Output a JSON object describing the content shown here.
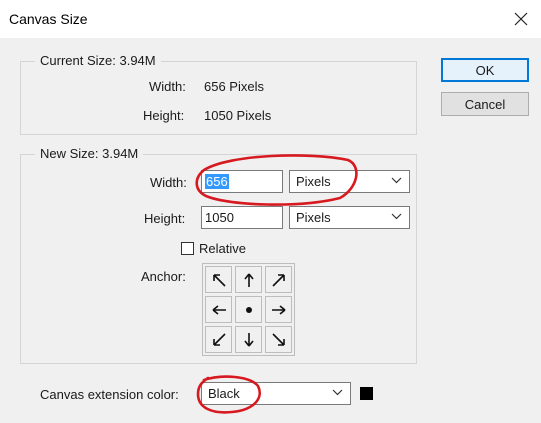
{
  "window": {
    "title": "Canvas Size"
  },
  "buttons": {
    "ok": "OK",
    "cancel": "Cancel"
  },
  "current_size": {
    "legend": "Current Size: 3.94M",
    "width_label": "Width:",
    "width_value": "656 Pixels",
    "height_label": "Height:",
    "height_value": "1050 Pixels"
  },
  "new_size": {
    "legend": "New Size: 3.94M",
    "width_label": "Width:",
    "width_value": "656",
    "width_unit": "Pixels",
    "height_label": "Height:",
    "height_value": "1050",
    "height_unit": "Pixels",
    "relative_label": "Relative",
    "relative_checked": false,
    "anchor_label": "Anchor:",
    "anchor_selected": "center"
  },
  "extension": {
    "label": "Canvas extension color:",
    "value": "Black",
    "swatch_color": "#000000"
  },
  "colors": {
    "annotation": "#d71920",
    "selection": "#3399ff",
    "primary_border": "#0078d7"
  },
  "icons": {
    "close": "close-icon",
    "chevron": "chevron-down-icon",
    "anchor": [
      "arrow-up-left-icon",
      "arrow-up-icon",
      "arrow-up-right-icon",
      "arrow-left-icon",
      "anchor-center-dot-icon",
      "arrow-right-icon",
      "arrow-down-left-icon",
      "arrow-down-icon",
      "arrow-down-right-icon"
    ]
  }
}
